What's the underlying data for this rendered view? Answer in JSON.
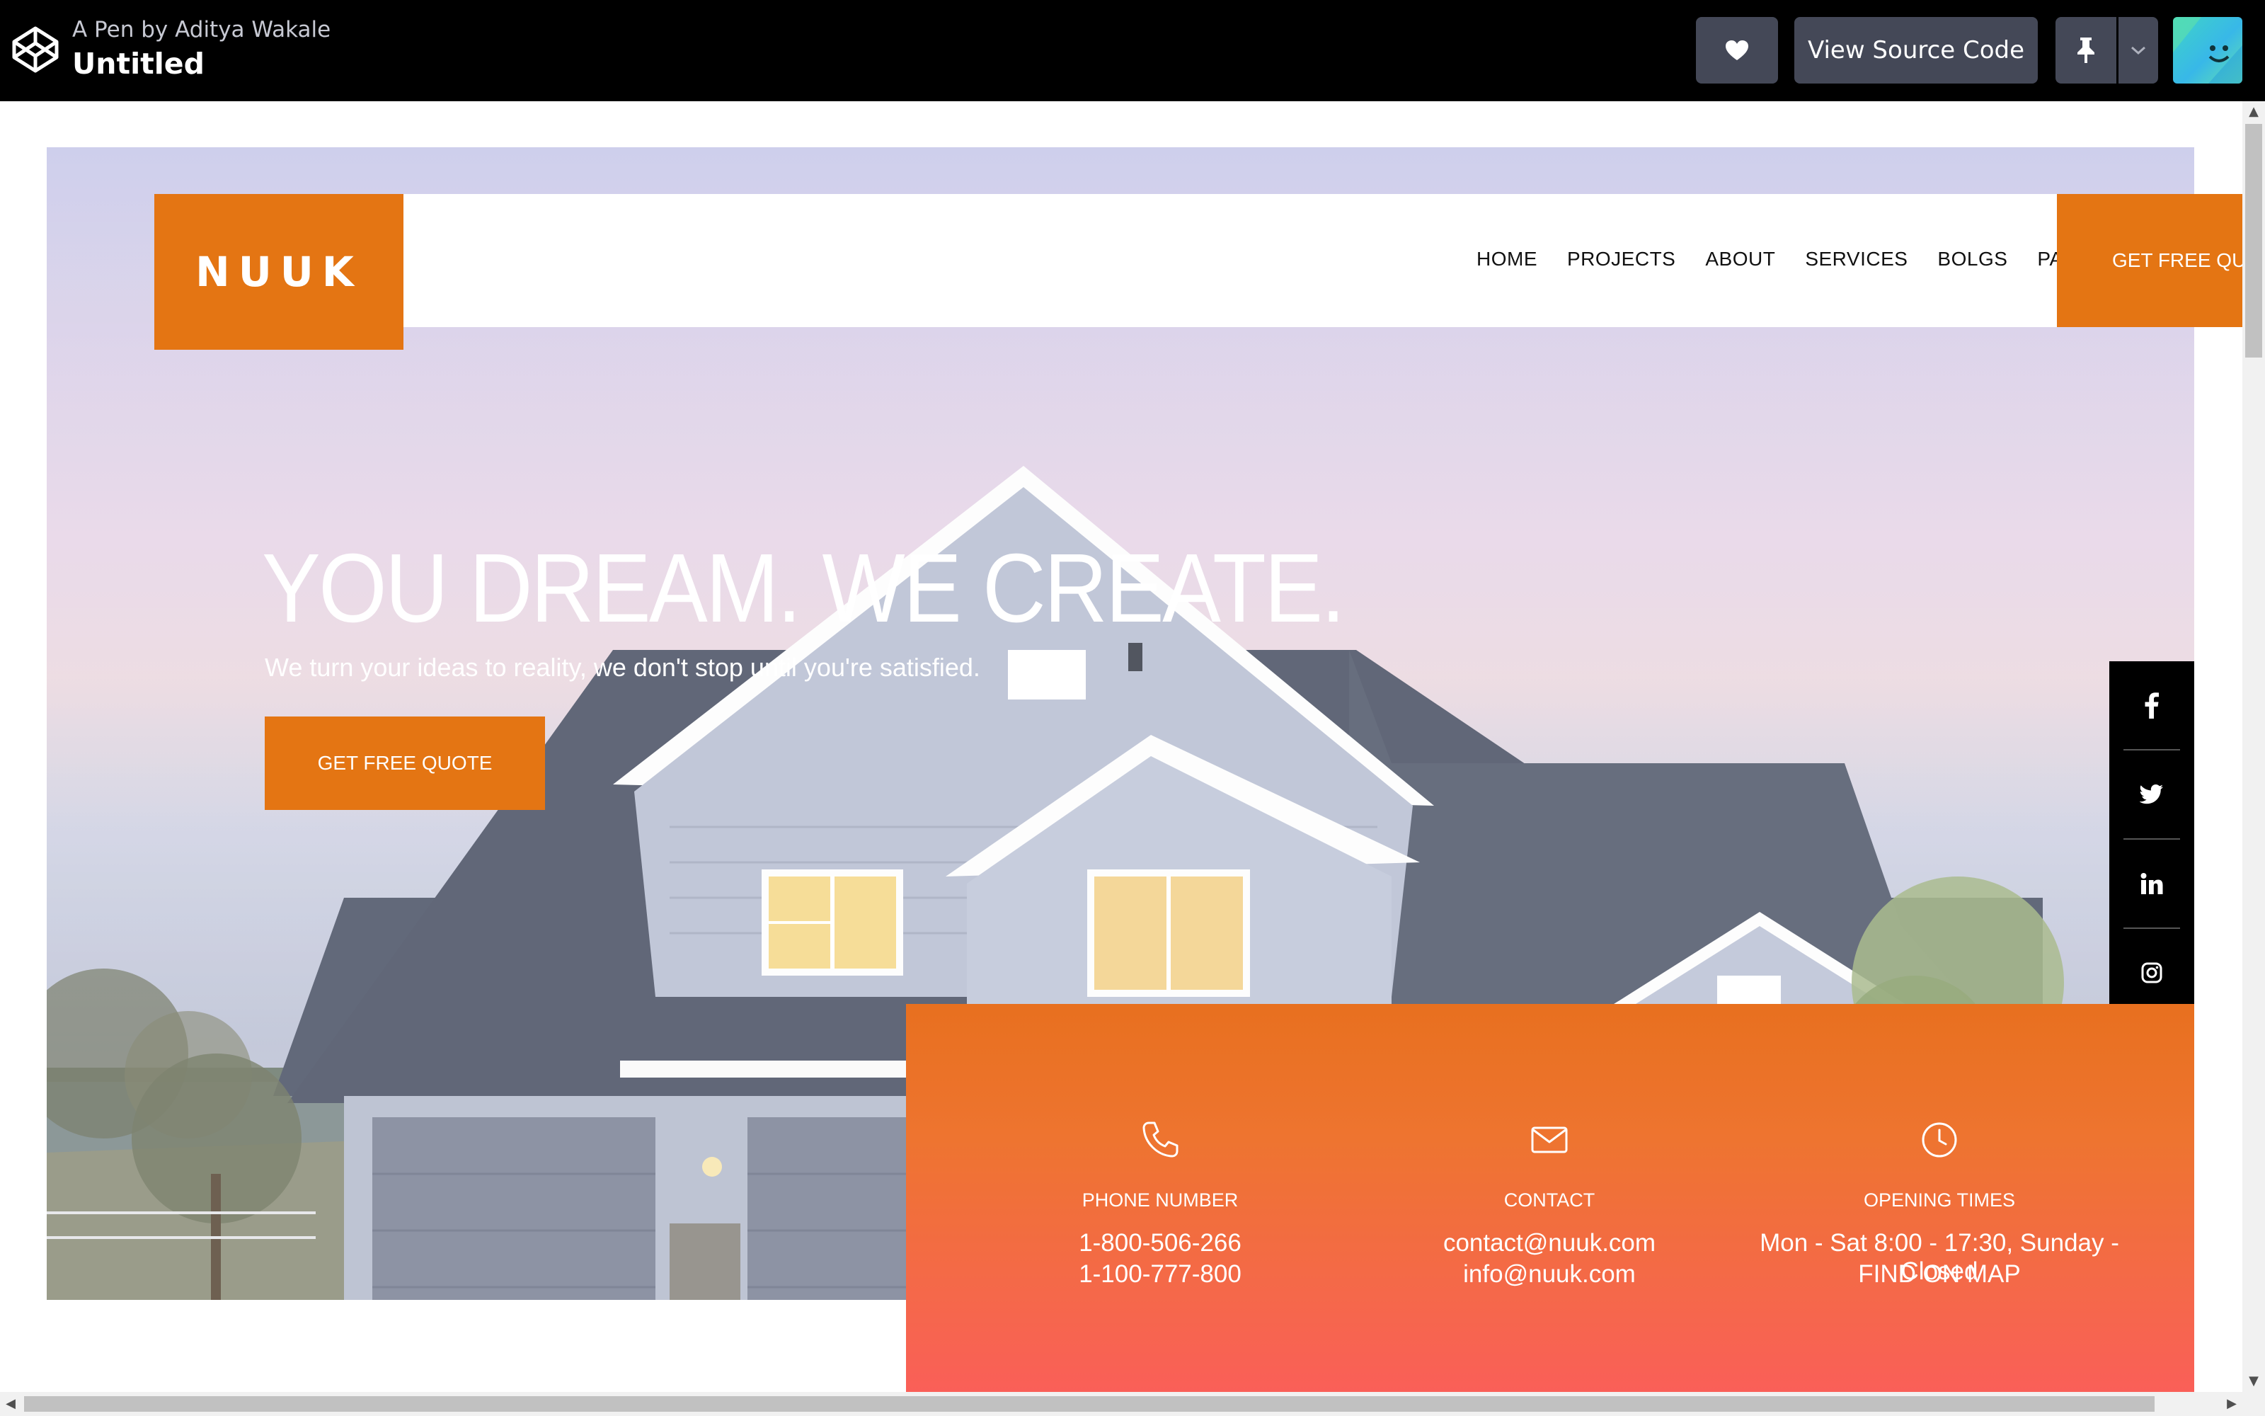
{
  "codepen": {
    "author": "A Pen by Aditya Wakale",
    "title": "Untitled",
    "view_source": "View Source Code",
    "icons": [
      "codepen-logo-icon",
      "heart-icon",
      "pin-icon",
      "chevron-down-icon",
      "avatar-icon"
    ]
  },
  "site": {
    "logo": "NUUK",
    "nav": [
      "HOME",
      "PROJECTS",
      "ABOUT",
      "SERVICES",
      "BOLGS",
      "PAGES"
    ],
    "nav_cta": "GET FREE QUOTE",
    "hero": {
      "title": "YOU DREAM. WE CREATE.",
      "subtitle": "We turn your ideas to reality, we don't stop until you're satisfied.",
      "button": "GET FREE QUOTE"
    },
    "social": [
      "facebook-icon",
      "twitter-icon",
      "linkedin-icon",
      "instagram-icon"
    ],
    "contact": [
      {
        "icon": "phone-icon",
        "label": "PHONE NUMBER",
        "line1": "1-800-506-266",
        "line2": "1-100-777-800"
      },
      {
        "icon": "mail-icon",
        "label": "CONTACT",
        "line1": "contact@nuuk.com",
        "line2": "info@nuuk.com"
      },
      {
        "icon": "clock-icon",
        "label": "OPENING TIMES",
        "line1": "Mon - Sat 8:00 - 17:30, Sunday - Closed",
        "line2": "FIND ON MAP"
      }
    ],
    "colors": {
      "brand": "#e47513",
      "panel_top": "#e8701f",
      "panel_bottom": "#fa5f58"
    }
  }
}
